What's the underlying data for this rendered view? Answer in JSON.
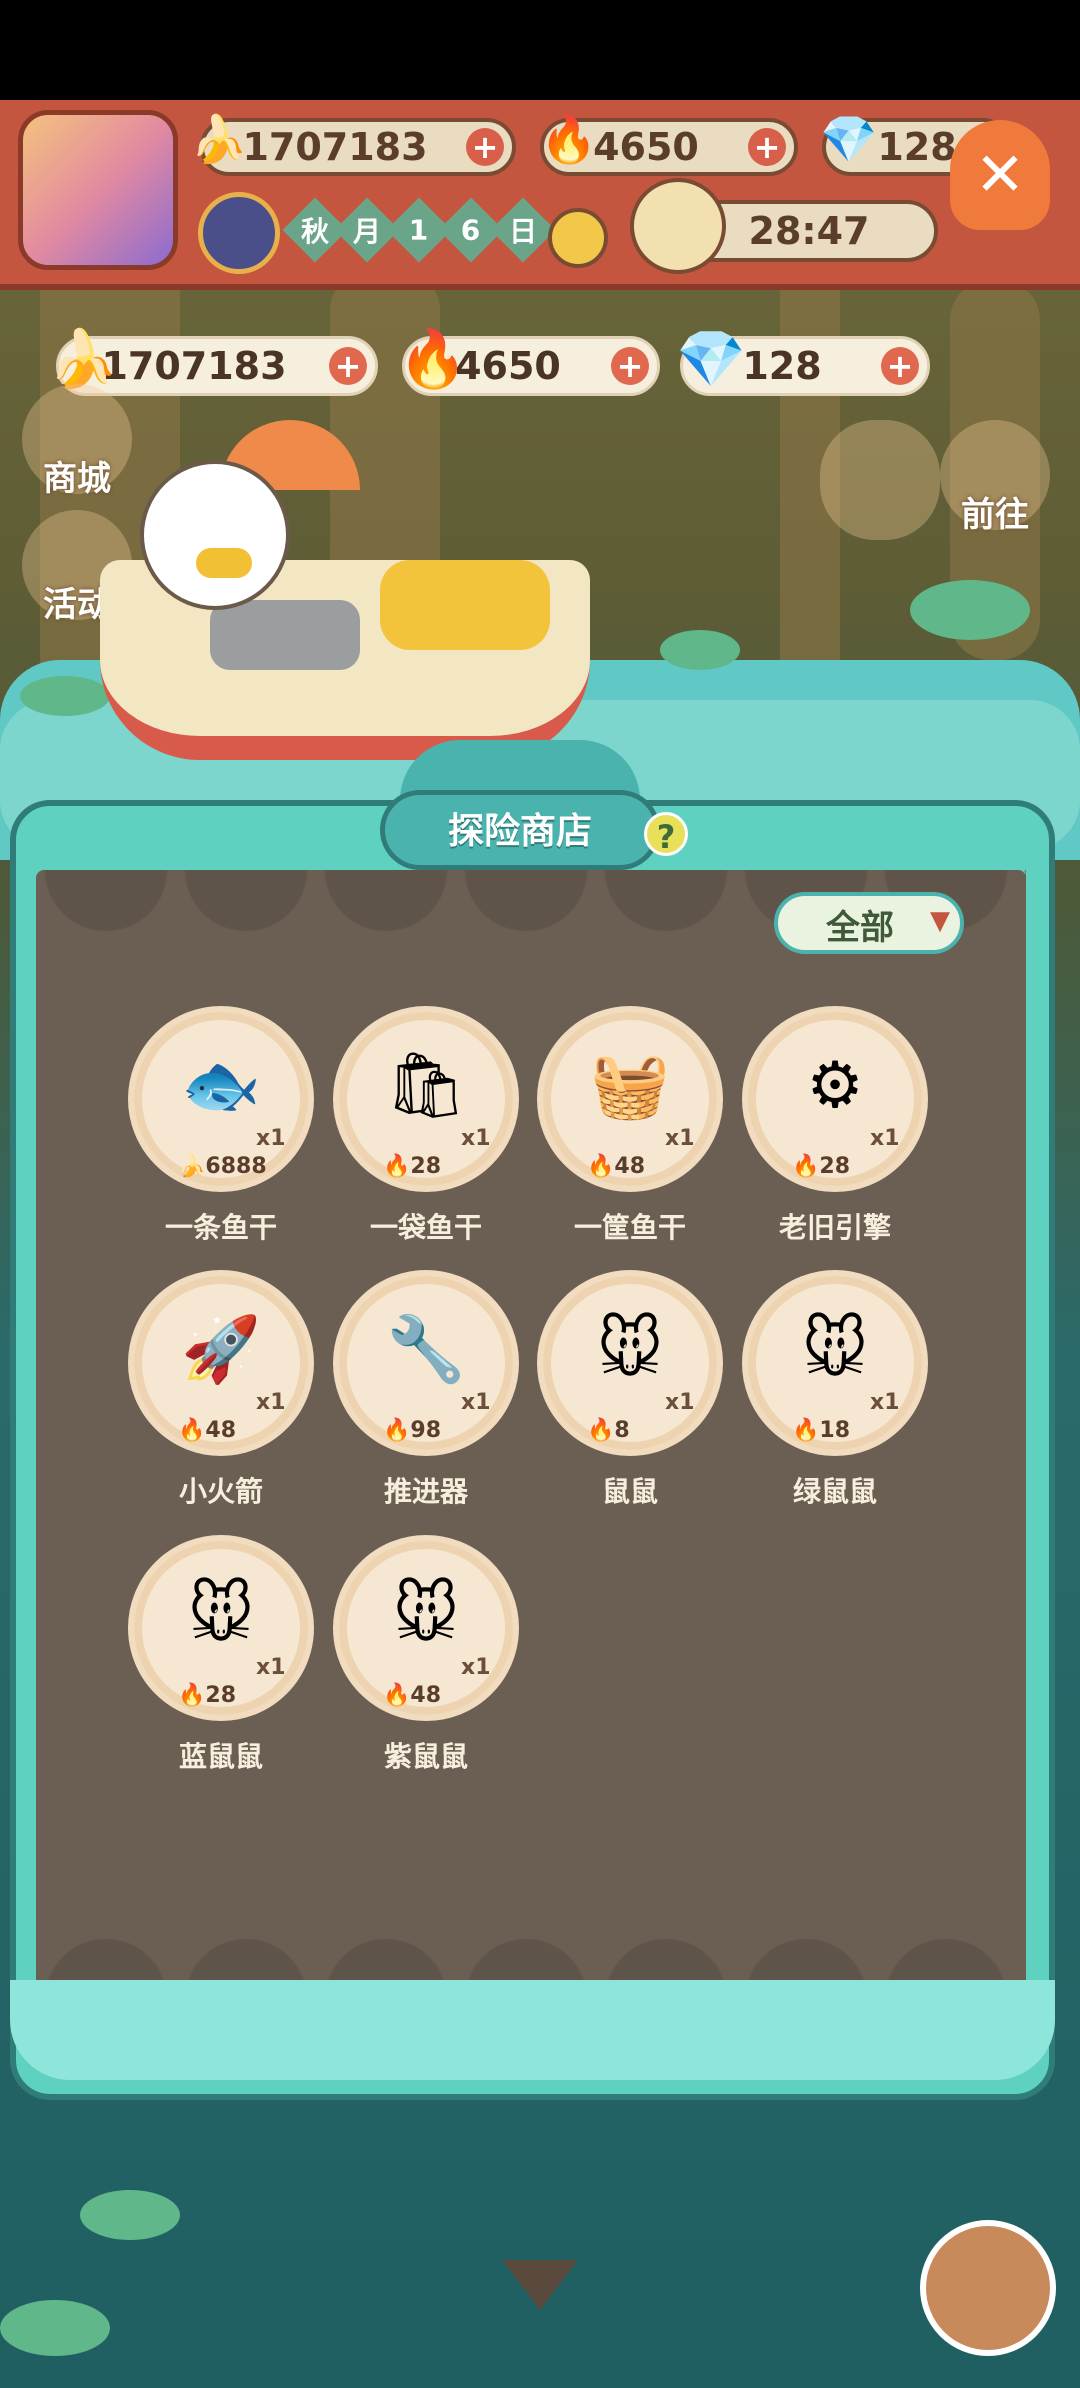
{
  "hud": {
    "bananas": "1707183",
    "flames": "4650",
    "gems": "128",
    "date_chars": [
      "秋",
      "月",
      "1",
      "6",
      "日"
    ],
    "timer": "28:47"
  },
  "currency": {
    "bananas": "1707183",
    "flames": "4650",
    "gems": "128"
  },
  "side": {
    "shop": "商城",
    "events": "活动",
    "go": "前往"
  },
  "panel": {
    "title": "探险商店",
    "help": "?",
    "filter": "全部"
  },
  "items": [
    {
      "name": "一条鱼干",
      "qty": "x1",
      "price": "6888",
      "currency": "banana",
      "icon": "fish-icon"
    },
    {
      "name": "一袋鱼干",
      "qty": "x1",
      "price": "28",
      "currency": "flame",
      "icon": "fish-bag-icon"
    },
    {
      "name": "一筐鱼干",
      "qty": "x1",
      "price": "48",
      "currency": "flame",
      "icon": "fish-basket-icon"
    },
    {
      "name": "老旧引擎",
      "qty": "x1",
      "price": "28",
      "currency": "flame",
      "icon": "engine-icon"
    },
    {
      "name": "小火箭",
      "qty": "x1",
      "price": "48",
      "currency": "flame",
      "icon": "rocket-icon"
    },
    {
      "name": "推进器",
      "qty": "x1",
      "price": "98",
      "currency": "flame",
      "icon": "thruster-icon"
    },
    {
      "name": "鼠鼠",
      "qty": "x1",
      "price": "8",
      "currency": "flame",
      "icon": "mouse-toy-icon"
    },
    {
      "name": "绿鼠鼠",
      "qty": "x1",
      "price": "18",
      "currency": "flame",
      "icon": "green-mouse-toy-icon"
    },
    {
      "name": "蓝鼠鼠",
      "qty": "x1",
      "price": "28",
      "currency": "flame",
      "icon": "blue-mouse-toy-icon"
    },
    {
      "name": "紫鼠鼠",
      "qty": "x1",
      "price": "48",
      "currency": "flame",
      "icon": "purple-mouse-toy-icon"
    }
  ],
  "colors": {
    "accent": "#4bb3ad",
    "panel": "#6b5e52",
    "hud": "#c4563f"
  }
}
